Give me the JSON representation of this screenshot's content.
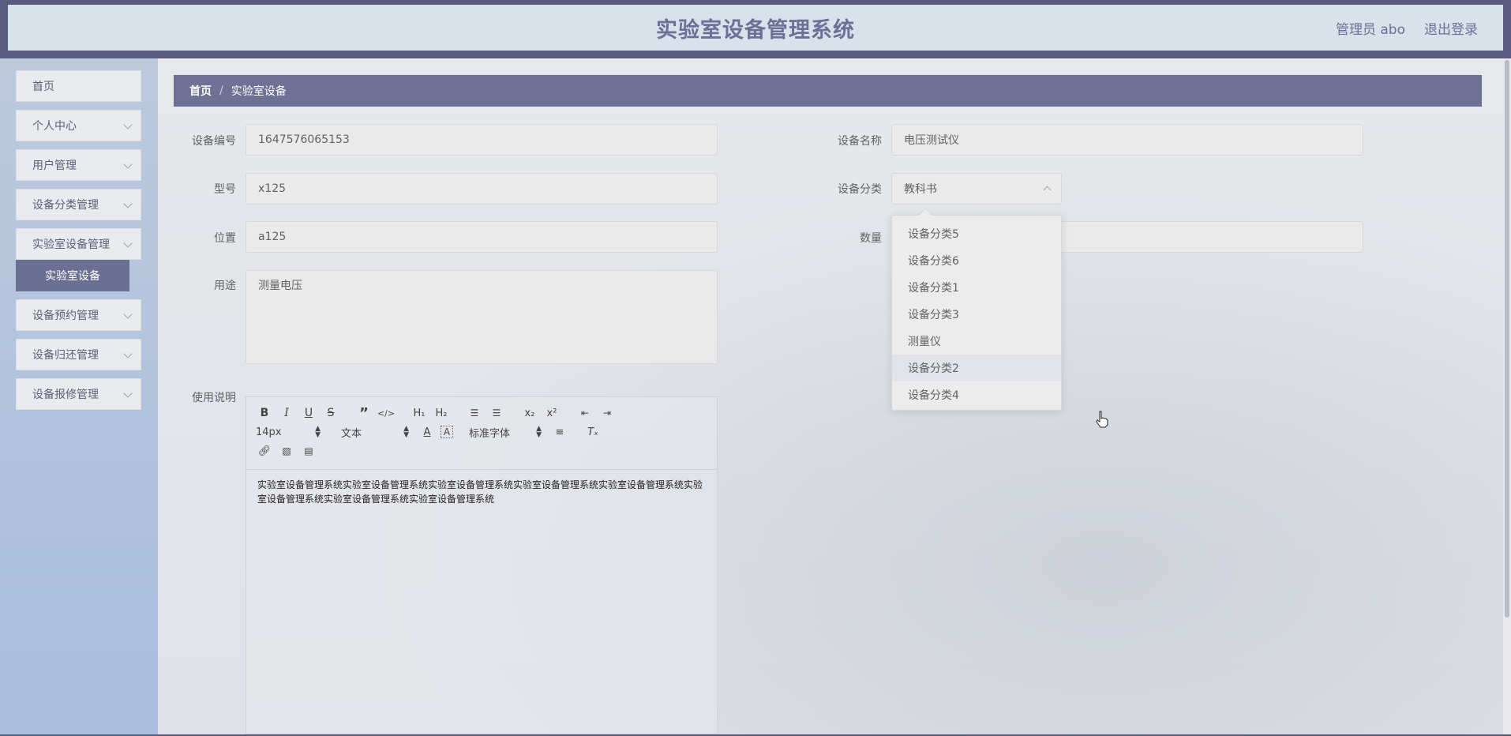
{
  "header": {
    "title": "实验室设备管理系统",
    "user": "管理员 abo",
    "logout": "退出登录"
  },
  "sidebar": {
    "items": [
      {
        "label": "首页"
      },
      {
        "label": "个人中心"
      },
      {
        "label": "用户管理"
      },
      {
        "label": "设备分类管理"
      },
      {
        "label": "实验室设备管理"
      },
      {
        "label": "设备预约管理"
      },
      {
        "label": "设备归还管理"
      },
      {
        "label": "设备报修管理"
      }
    ],
    "submenu": {
      "label": "实验室设备"
    }
  },
  "breadcrumb": {
    "home": "首页",
    "separator": "/",
    "current": "实验室设备"
  },
  "form": {
    "device_no_label": "设备编号",
    "device_no": "1647576065153",
    "device_name_label": "设备名称",
    "device_name": "电压测试仪",
    "model_label": "型号",
    "model": "x125",
    "category_label": "设备分类",
    "category": "教科书",
    "location_label": "位置",
    "location": "a125",
    "quantity_label": "数量",
    "usage_label": "用途",
    "usage": "测量电压",
    "manual_label": "使用说明"
  },
  "dropdown": {
    "options": [
      "设备分类5",
      "设备分类6",
      "设备分类1",
      "设备分类3",
      "测量仪",
      "设备分类2",
      "设备分类4"
    ],
    "hovered_index": 5
  },
  "editor": {
    "font_size": "14px",
    "text_type": "文本",
    "font_family": "标准字体",
    "content": "实验室设备管理系统实验室设备管理系统实验室设备管理系统实验室设备管理系统实验室设备管理系统实验室设备管理系统实验室设备管理系统实验室设备管理系统"
  },
  "colors": {
    "accent": "#6e7193",
    "header_bg": "#d7e2ea",
    "title": "#6c7096"
  }
}
